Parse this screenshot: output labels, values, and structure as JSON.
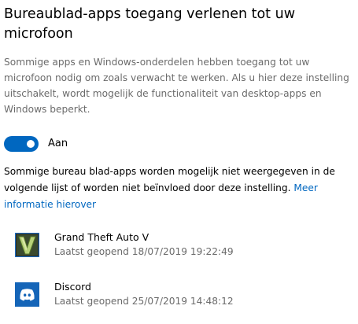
{
  "title": "Bureaublad-apps toegang verlenen tot uw microfoon",
  "description": "Sommige apps en Windows-onderdelen hebben toegang tot uw microfoon nodig om zoals verwacht te werken. Als u hier deze instelling uitschakelt, wordt mogelijk de functionaliteit van desktop-apps en Windows beperkt.",
  "toggle": {
    "state": "on",
    "label": "Aan",
    "color": "#0067c0"
  },
  "info": {
    "text": "Sommige bureau blad-apps worden mogelijk niet weergegeven in de volgende lijst of worden niet beïnvloed door deze instelling.",
    "link": "Meer informatie hierover"
  },
  "apps": [
    {
      "name": "Grand Theft Auto V",
      "date": "Laatst geopend 18/07/2019 19:22:49",
      "icon": "gta-v-icon"
    },
    {
      "name": "Discord",
      "date": "Laatst geopend 25/07/2019 14:48:12",
      "icon": "discord-icon"
    }
  ]
}
